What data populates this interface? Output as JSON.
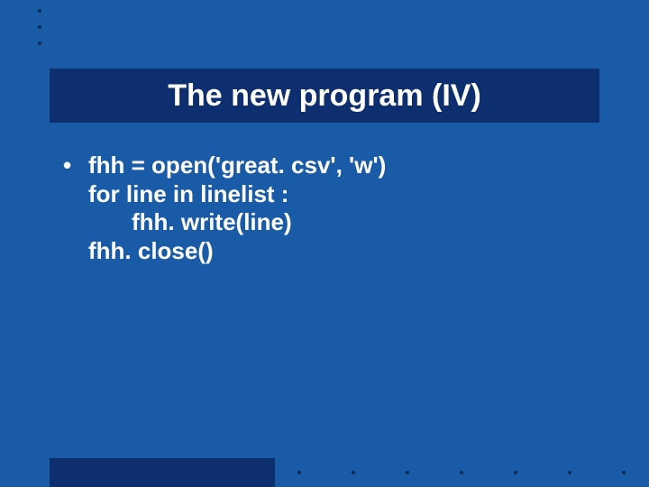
{
  "title": "The new program (IV)",
  "bullet": {
    "marker": "•",
    "lines": [
      "fhh = open('great. csv', 'w')",
      "for line in linelist :",
      "fhh. write(line)",
      "fhh. close()"
    ]
  }
}
